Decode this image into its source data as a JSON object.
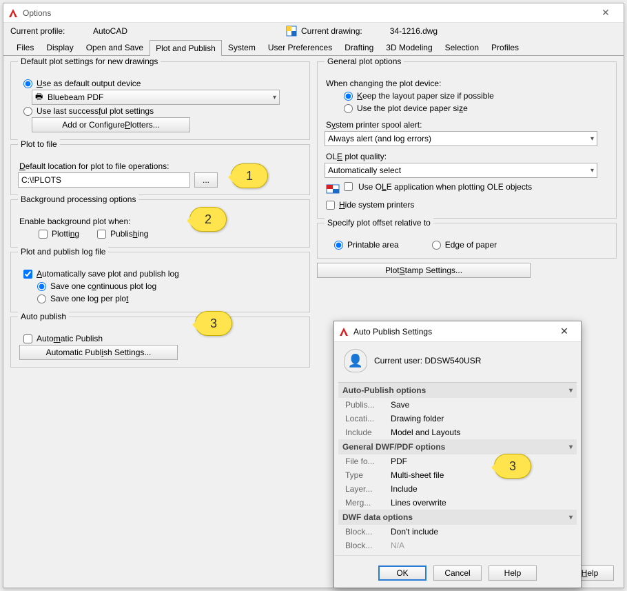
{
  "window": {
    "title": "Options"
  },
  "profile": {
    "label": "Current profile:",
    "value": "AutoCAD",
    "drawingLabel": "Current drawing:",
    "drawingValue": "34-1216.dwg"
  },
  "tabs": [
    "Files",
    "Display",
    "Open and Save",
    "Plot and Publish",
    "System",
    "User Preferences",
    "Drafting",
    "3D Modeling",
    "Selection",
    "Profiles"
  ],
  "activeTab": "Plot and Publish",
  "left": {
    "defaultPlot": {
      "title": "Default plot settings for new drawings",
      "useDefault": "Use as default output device",
      "device": "Bluebeam PDF",
      "useLast": "Use last successful plot settings",
      "addConfigure": "Add or Configure Plotters..."
    },
    "plotToFile": {
      "title": "Plot to file",
      "locLabel": "Default location for plot to file operations:",
      "locValue": "C:\\!PLOTS"
    },
    "bg": {
      "title": "Background processing options",
      "enable": "Enable background plot when:",
      "plotting": "Plotting",
      "publishing": "Publishing"
    },
    "log": {
      "title": "Plot and publish log file",
      "autosave": "Automatically save plot and publish log",
      "oneCont": "Save one continuous plot log",
      "onePer": "Save one log per plot"
    },
    "autoPub": {
      "title": "Auto publish",
      "check": "Automatic Publish",
      "btn": "Automatic Publish Settings..."
    }
  },
  "right": {
    "general": {
      "title": "General plot options",
      "whenChange": "When changing the plot device:",
      "keepLayout": "Keep the layout paper size if possible",
      "useDevice": "Use the plot device paper size",
      "spoolLabel": "System printer spool alert:",
      "spoolValue": "Always alert (and log errors)",
      "oleLabel": "OLE plot quality:",
      "oleValue": "Automatically select",
      "oleApp": "Use OLE application when plotting OLE objects",
      "hide": "Hide system printers"
    },
    "offset": {
      "title": "Specify plot offset relative to",
      "printable": "Printable area",
      "edge": "Edge of paper"
    },
    "stampBtn": "Plot Stamp Settings..."
  },
  "dialog2": {
    "title": "Auto Publish Settings",
    "userLabel": "Current user:",
    "userValue": "DDSW540USR",
    "sections": {
      "autoPub": {
        "header": "Auto-Publish options",
        "rows": [
          {
            "k": "Publis...",
            "v": "Save"
          },
          {
            "k": "Locati...",
            "v": "Drawing folder"
          },
          {
            "k": "Include",
            "v": "Model and Layouts"
          }
        ]
      },
      "general": {
        "header": "General DWF/PDF options",
        "rows": [
          {
            "k": "File fo...",
            "v": "PDF"
          },
          {
            "k": "Type",
            "v": "Multi-sheet file"
          },
          {
            "k": "Layer...",
            "v": "Include"
          },
          {
            "k": "Merg...",
            "v": "Lines overwrite"
          }
        ]
      },
      "dwf": {
        "header": "DWF data options",
        "rows": [
          {
            "k": "Block...",
            "v": "Don't include"
          },
          {
            "k": "Block...",
            "v": "N/A",
            "dim": true
          }
        ]
      }
    },
    "ok": "OK",
    "cancel": "Cancel",
    "help": "Help"
  },
  "helpBtn": "Help",
  "callouts": {
    "c1": "1",
    "c2": "2",
    "c3a": "3",
    "c3b": "3"
  },
  "brand": {
    "red": "#d5201f"
  }
}
